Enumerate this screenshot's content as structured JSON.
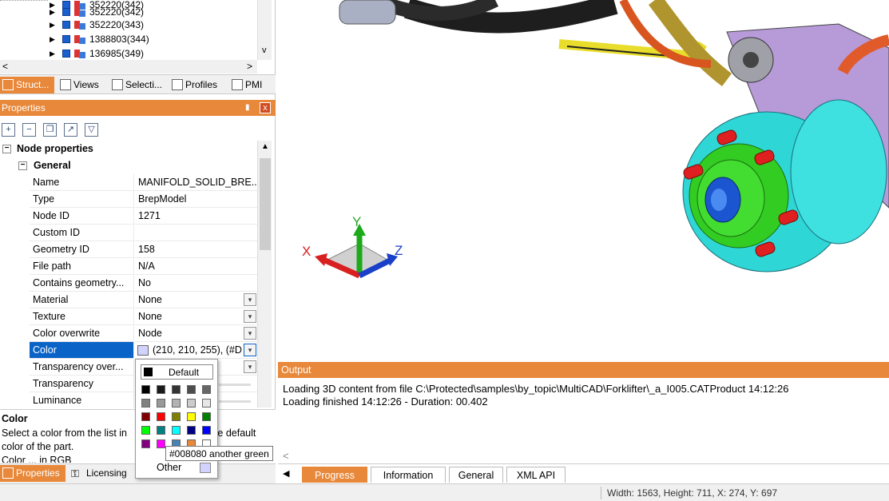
{
  "tree": {
    "rows": [
      {
        "label": "352220(342)"
      },
      {
        "label": "352220(343)"
      },
      {
        "label": "1388803(344)"
      },
      {
        "label": "136985(349)"
      }
    ],
    "hscroll_left": "<",
    "hscroll_right": ">",
    "vscroll_down": "v"
  },
  "top_tabs": [
    {
      "label": "Struct...",
      "icon": "structure-icon"
    },
    {
      "label": "Views",
      "icon": "views-icon"
    },
    {
      "label": "Selecti...",
      "icon": "selection-icon"
    },
    {
      "label": "Profiles",
      "icon": "profiles-icon"
    },
    {
      "label": "PMI",
      "icon": "pmi-icon"
    }
  ],
  "properties": {
    "title": "Properties",
    "pin": "▮",
    "close": "x",
    "toolbar": [
      "expand-all-icon",
      "collapse-all-icon",
      "copy-icon",
      "export-icon",
      "filter-icon"
    ],
    "group_label": "Node properties",
    "subgroup_label": "General",
    "rows": [
      {
        "name": "Name",
        "value": "MANIFOLD_SOLID_BRE...",
        "dropdown": false
      },
      {
        "name": "Type",
        "value": "BrepModel",
        "dropdown": false
      },
      {
        "name": "Node ID",
        "value": "1271",
        "dropdown": false
      },
      {
        "name": "Custom ID",
        "value": "",
        "dropdown": false
      },
      {
        "name": "Geometry ID",
        "value": "158",
        "dropdown": false
      },
      {
        "name": "File path",
        "value": "N/A",
        "dropdown": false
      },
      {
        "name": "Contains geometry...",
        "value": "No",
        "dropdown": false
      },
      {
        "name": "Material",
        "value": "None",
        "dropdown": true
      },
      {
        "name": "Texture",
        "value": "None",
        "dropdown": true
      },
      {
        "name": "Color overwrite",
        "value": "Node",
        "dropdown": true
      },
      {
        "name": "Color",
        "value": "(210, 210, 255), (#D",
        "dropdown": true,
        "selected": true,
        "swatch": "#d2d2ff"
      },
      {
        "name": "Transparency over...",
        "value": "",
        "dropdown": true
      },
      {
        "name": "Transparency",
        "value": "",
        "dropdown": false
      },
      {
        "name": "Luminance",
        "value": "",
        "dropdown": false
      }
    ]
  },
  "description": {
    "title": "Color",
    "line1a": "Select a color from the list in",
    "line1b": "the default",
    "line2": "color of the part.",
    "line3": "Color ... in RGB"
  },
  "bottom_tabs": [
    {
      "label": "Properties",
      "icon": "properties-icon"
    },
    {
      "label": "Licensing",
      "icon": "key-icon"
    }
  ],
  "color_popup": {
    "default_label": "Default",
    "default_swatch": "#000000",
    "swatches": [
      [
        "#000000",
        "#1a1a1a",
        "#333333",
        "#4d4d4d",
        "#666666"
      ],
      [
        "#808080",
        "#999999",
        "#b3b3b3",
        "#cccccc",
        "#e6e6e6"
      ],
      [
        "#800000",
        "#ff0000",
        "#808000",
        "#ffff00",
        "#008000"
      ],
      [
        "#00ff00",
        "#008080",
        "#00ffff",
        "#000080",
        "#0000ff"
      ],
      [
        "#800080",
        "#ff00ff",
        "#4682b4",
        "#e8883a",
        "#ffffff"
      ]
    ],
    "other_label": "Other",
    "other_swatch": "#d2d2ff"
  },
  "tooltip": "#008080 another green",
  "axes": {
    "x": "X",
    "y": "Y",
    "z": "Z"
  },
  "output": {
    "title": "Output",
    "lines": [
      "Loading 3D content from file C:\\Protected\\samples\\by_topic\\MultiCAD\\Forklifter\\_a_I005.CATProduct 14:12:26",
      "Loading finished 14:12:26 - Duration: 00.402"
    ],
    "scroll_left": "<"
  },
  "output_tabs": [
    {
      "label": "Progress",
      "active": true
    },
    {
      "label": "Information",
      "active": false
    },
    {
      "label": "General",
      "active": false
    },
    {
      "label": "XML API",
      "active": false
    }
  ],
  "output_tabs_nav": "◀",
  "status": {
    "text": "Width: 1563, Height: 711, X: 274, Y: 697"
  },
  "colors": {
    "accent": "#e8883a",
    "selection": "#0a64c8",
    "model_cyan": "#2fd6d6",
    "model_green": "#33cc22",
    "model_purple": "#b79ad8",
    "model_red": "#e02020"
  }
}
